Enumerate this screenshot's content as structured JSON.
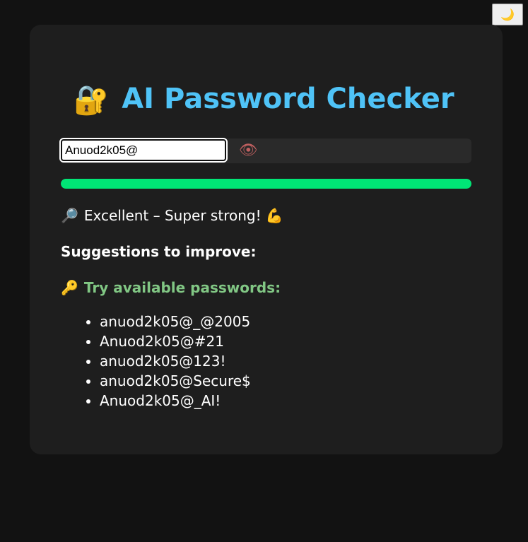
{
  "theme_toggle": {
    "icon": "moon-icon",
    "glyph": "🌙"
  },
  "header": {
    "lock_glyph": "🔐",
    "title": "AI Password Checker"
  },
  "password": {
    "value": "Anuod2k05@",
    "eye_glyph": "👁"
  },
  "strength": {
    "fill_fraction": 1.0,
    "color": "#00e676",
    "icon_glyph": "🔎",
    "text": "Excellent – Super strong!",
    "trail_glyph": "💪"
  },
  "suggestions": {
    "heading": "Suggestions to improve:",
    "available_icon": "🔑",
    "available_heading": "Try available passwords:",
    "items": [
      "anuod2k05@_@2005",
      "Anuod2k05@#21",
      "anuod2k05@123!",
      "anuod2k05@Secure$",
      "Anuod2k05@_AI!"
    ]
  }
}
